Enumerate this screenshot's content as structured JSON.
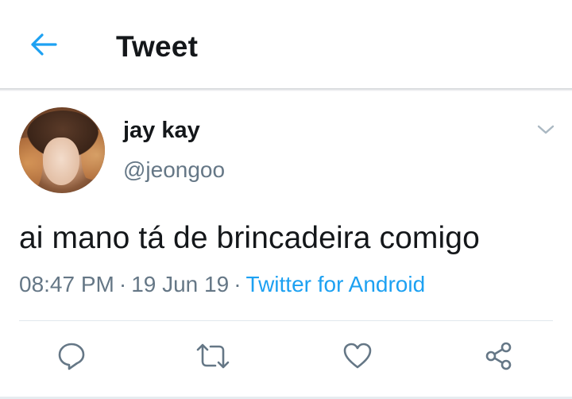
{
  "header": {
    "title": "Tweet",
    "back_icon": "arrow-left-icon",
    "accent_color": "#1da1f2"
  },
  "tweet": {
    "author": {
      "display_name": "jay kay",
      "handle": "@jeongoo",
      "avatar": "profile-photo"
    },
    "text": "ai mano tá de brincadeira comigo",
    "time": "08:47 PM",
    "date": "19 Jun 19",
    "separator": "·",
    "client": "Twitter for Android",
    "menu_icon": "chevron-down-icon"
  },
  "actions": [
    {
      "name": "reply",
      "icon": "reply-icon"
    },
    {
      "name": "retweet",
      "icon": "retweet-icon"
    },
    {
      "name": "like",
      "icon": "heart-icon"
    },
    {
      "name": "share",
      "icon": "share-icon"
    }
  ],
  "colors": {
    "text_primary": "#14171a",
    "text_secondary": "#657786",
    "link": "#1da1f2",
    "divider": "#e1e8ed"
  }
}
